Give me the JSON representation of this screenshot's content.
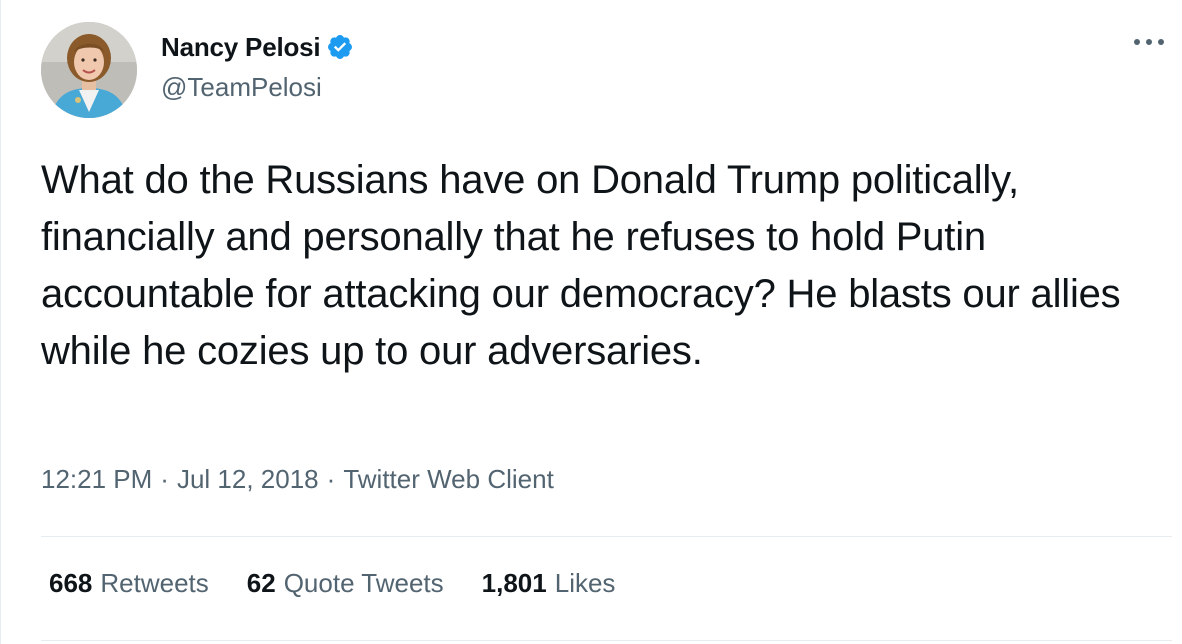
{
  "tweet": {
    "author": {
      "display_name": "Nancy Pelosi",
      "handle": "@TeamPelosi",
      "verified": true
    },
    "text": "What do the Russians have on Donald Trump politically, financially and personally that he refuses to hold Putin accountable for attacking our democracy? He blasts our allies while he cozies up to our adversaries.",
    "time": "12:21 PM",
    "date": "Jul 12, 2018",
    "client": "Twitter Web Client",
    "separator": "·",
    "stats": {
      "retweets_count": "668",
      "retweets_label": "Retweets",
      "quotes_count": "62",
      "quotes_label": "Quote Tweets",
      "likes_count": "1,801",
      "likes_label": "Likes"
    }
  },
  "colors": {
    "verified_badge": "#1d9bf0",
    "secondary_text": "#536471",
    "primary_text": "#0f1419",
    "divider": "#e6ecf0"
  },
  "icons": {
    "verified": "verified-badge-icon",
    "more": "more-options-icon"
  }
}
